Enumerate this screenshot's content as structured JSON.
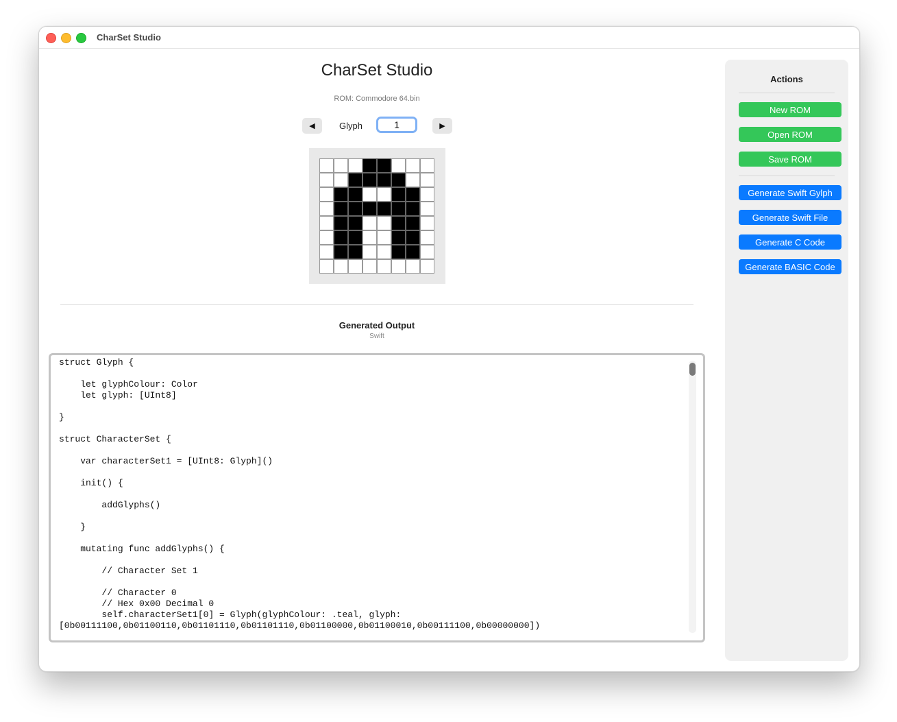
{
  "window": {
    "title": "CharSet Studio"
  },
  "header": {
    "app_title": "CharSet Studio",
    "rom_label": "ROM: Commodore 64.bin"
  },
  "glyph_nav": {
    "prev_label": "◀",
    "label": "Glyph",
    "value": "1",
    "next_label": "▶"
  },
  "glyph_bitmap": [
    "00011000",
    "00111100",
    "01100110",
    "01111110",
    "01100110",
    "01100110",
    "01100110",
    "00000000"
  ],
  "output": {
    "title": "Generated Output",
    "language": "Swift",
    "code": "struct Glyph {\n\n    let glyphColour: Color\n    let glyph: [UInt8]\n\n}\n\nstruct CharacterSet {\n\n    var characterSet1 = [UInt8: Glyph]()\n\n    init() {\n\n        addGlyphs()\n\n    }\n\n    mutating func addGlyphs() {\n\n        // Character Set 1\n\n        // Character 0\n        // Hex 0x00 Decimal 0\n        self.characterSet1[0] = Glyph(glyphColour: .teal, glyph:\n[0b00111100,0b01100110,0b01101110,0b01101110,0b01100000,0b01100010,0b00111100,0b00000000])"
  },
  "sidebar": {
    "title": "Actions",
    "rom_buttons": [
      "New ROM",
      "Open ROM",
      "Save ROM"
    ],
    "generate_buttons": [
      "Generate Swift Gylph",
      "Generate Swift File",
      "Generate C Code",
      "Generate BASIC Code"
    ]
  },
  "colors": {
    "green_button": "#34c759",
    "blue_button": "#0a7aff",
    "pixel_on": "#000000",
    "pixel_off": "#ffffff"
  }
}
